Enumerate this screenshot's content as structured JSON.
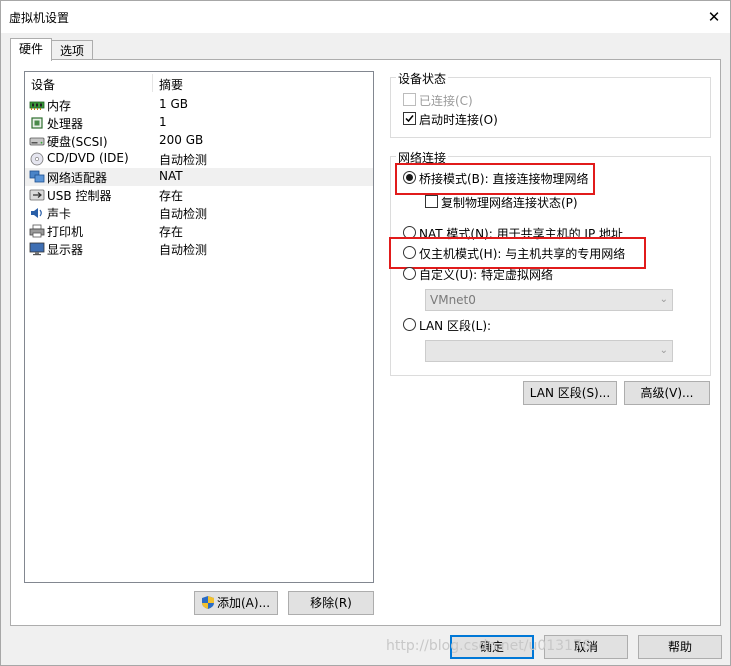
{
  "window": {
    "title": "虚拟机设置",
    "close_glyph": "✕"
  },
  "tabs": [
    {
      "label": "硬件",
      "active": true
    },
    {
      "label": "选项",
      "active": false
    }
  ],
  "device_list": {
    "headers": {
      "device": "设备",
      "summary": "摘要"
    },
    "rows": [
      {
        "icon": "memory-icon",
        "name": "内存",
        "summary": "1 GB"
      },
      {
        "icon": "processor-icon",
        "name": "处理器",
        "summary": "1"
      },
      {
        "icon": "hard-disk-icon",
        "name": "硬盘(SCSI)",
        "summary": "200 GB"
      },
      {
        "icon": "cd-dvd-icon",
        "name": "CD/DVD (IDE)",
        "summary": "自动检测"
      },
      {
        "icon": "network-adapter-icon",
        "name": "网络适配器",
        "summary": "NAT",
        "selected": true
      },
      {
        "icon": "usb-icon",
        "name": "USB 控制器",
        "summary": "存在"
      },
      {
        "icon": "sound-card-icon",
        "name": "声卡",
        "summary": "自动检测"
      },
      {
        "icon": "printer-icon",
        "name": "打印机",
        "summary": "存在"
      },
      {
        "icon": "display-icon",
        "name": "显示器",
        "summary": "自动检测"
      }
    ]
  },
  "list_buttons": {
    "add": "添加(A)...",
    "remove": "移除(R)"
  },
  "device_status": {
    "title": "设备状态",
    "connected": {
      "label": "已连接(C)",
      "checked": false,
      "disabled": true
    },
    "connect_at_power_on": {
      "label": "启动时连接(O)",
      "checked": true
    }
  },
  "network_connection": {
    "title": "网络连接",
    "bridged": {
      "label": "桥接模式(B): 直接连接物理网络",
      "selected": true
    },
    "replicate": {
      "label": "复制物理网络连接状态(P)",
      "checked": false
    },
    "nat": {
      "label": "NAT 模式(N): 用于共享主机的 IP 地址",
      "selected": false
    },
    "host_only": {
      "label": "仅主机模式(H): 与主机共享的专用网络",
      "selected": false
    },
    "custom": {
      "label": "自定义(U): 特定虚拟网络",
      "selected": false
    },
    "custom_combo_value": "VMnet0",
    "lan_segment": {
      "label": "LAN 区段(L):",
      "selected": false
    },
    "lan_combo_value": ""
  },
  "network_buttons": {
    "lan_segments": "LAN 区段(S)...",
    "advanced": "高级(V)..."
  },
  "footer_buttons": {
    "ok": "确定",
    "cancel": "取消",
    "help": "帮助"
  },
  "watermark": "http://blog.csdn.net/u013176",
  "colors": {
    "highlight_box": "#e11b1b",
    "default_button_border": "#0078d7",
    "shield_blue": "#2b6cc4",
    "shield_yellow": "#f2c12e"
  }
}
